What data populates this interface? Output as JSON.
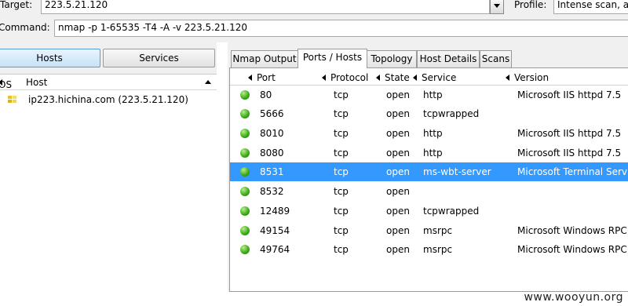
{
  "toolbar": {
    "target_label": "Target:",
    "target_value": "223.5.21.120",
    "profile_label": "Profile:",
    "profile_value": "Intense scan, al",
    "command_label": "Command:",
    "command_value": "nmap -p 1-65535 -T4 -A -v 223.5.21.120"
  },
  "left": {
    "hosts_button": "Hosts",
    "services_button": "Services",
    "col_os": "OS",
    "col_host": "Host",
    "hosts": [
      {
        "name": "ip223.hichina.com (223.5.21.120)",
        "os_icon": "windows-flag-icon"
      }
    ]
  },
  "tabs": [
    "Nmap Output",
    "Ports / Hosts",
    "Topology",
    "Host Details",
    "Scans"
  ],
  "active_tab": "Ports / Hosts",
  "ports": {
    "columns": [
      "Port",
      "Protocol",
      "State",
      "Service",
      "Version"
    ],
    "rows": [
      {
        "port": "80",
        "protocol": "tcp",
        "state": "open",
        "service": "http",
        "version": "Microsoft IIS httpd 7.5"
      },
      {
        "port": "5666",
        "protocol": "tcp",
        "state": "open",
        "service": "tcpwrapped",
        "version": ""
      },
      {
        "port": "8010",
        "protocol": "tcp",
        "state": "open",
        "service": "http",
        "version": "Microsoft IIS httpd 7.5"
      },
      {
        "port": "8080",
        "protocol": "tcp",
        "state": "open",
        "service": "http",
        "version": "Microsoft IIS httpd 7.5"
      },
      {
        "port": "8531",
        "protocol": "tcp",
        "state": "open",
        "service": "ms-wbt-server",
        "version": "Microsoft Terminal Servi"
      },
      {
        "port": "8532",
        "protocol": "tcp",
        "state": "open",
        "service": "",
        "version": ""
      },
      {
        "port": "12489",
        "protocol": "tcp",
        "state": "open",
        "service": "tcpwrapped",
        "version": ""
      },
      {
        "port": "49154",
        "protocol": "tcp",
        "state": "open",
        "service": "msrpc",
        "version": "Microsoft Windows RPC"
      },
      {
        "port": "49764",
        "protocol": "tcp",
        "state": "open",
        "service": "msrpc",
        "version": "Microsoft Windows RPC"
      }
    ],
    "selected_port": "8531",
    "state_icon": "green-status-dot-icon"
  },
  "watermark": "www.wooyun.org",
  "colors": {
    "selection": "#3399ff",
    "open_dot": "#3aa616"
  }
}
